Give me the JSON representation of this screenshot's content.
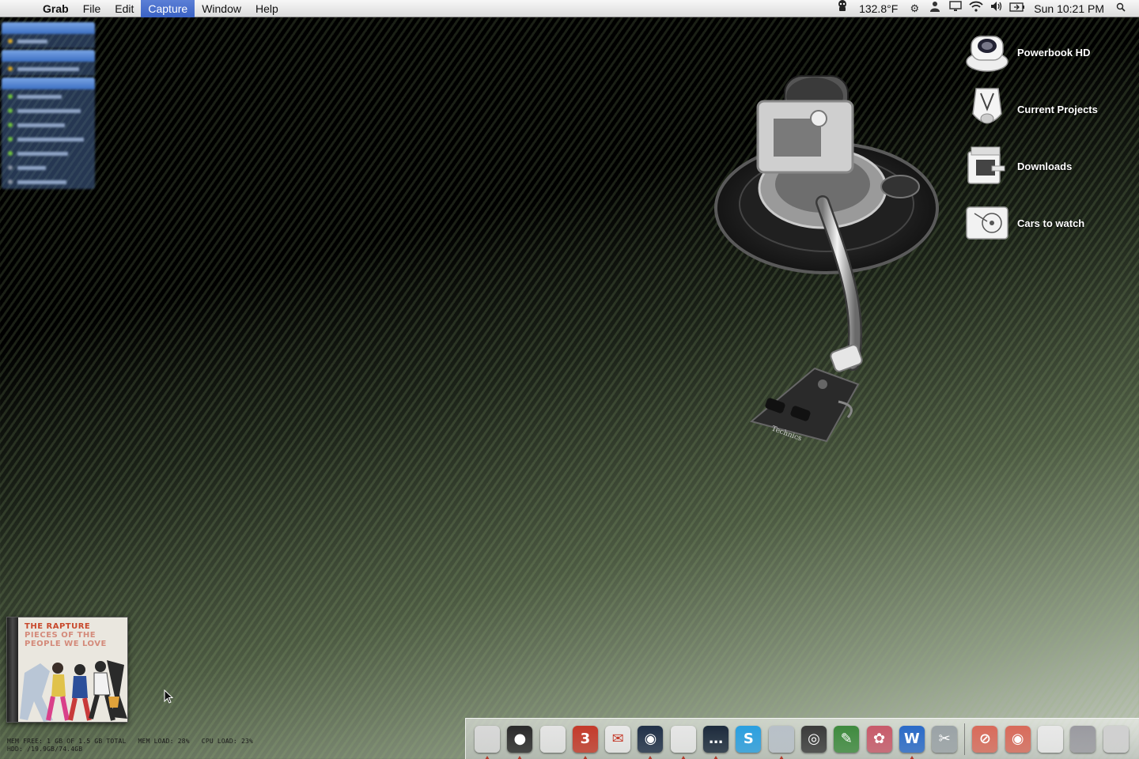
{
  "menubar": {
    "app_name": "Grab",
    "menus": [
      "File",
      "Edit",
      "Capture",
      "Window",
      "Help"
    ],
    "active_menu": "Capture",
    "temperature": "132.8°F",
    "clock": "Sun 10:21 PM",
    "status_icons": [
      "apple-icon",
      "temp-sensor-icon",
      "gear-icon",
      "user-icon",
      "display-icon",
      "wifi-icon",
      "volume-icon",
      "battery-icon",
      "spotlight-icon"
    ]
  },
  "desktop_icons": [
    {
      "label": "Powerbook HD",
      "icon": "hard-drive-icon"
    },
    {
      "label": "Current Projects",
      "icon": "projects-folder-icon"
    },
    {
      "label": "Downloads",
      "icon": "downloads-folder-icon"
    },
    {
      "label": "Cars to watch",
      "icon": "cars-folder-icon"
    }
  ],
  "album": {
    "band": "THE RAPTURE",
    "record": "PIECES OF THE PEOPLE WE LOVE"
  },
  "stats": {
    "line1": "MEM FREE: 1 GB OF 1.5 GB TOTAL   MEM LOAD: 28%   CPU LOAD: 23%",
    "line2": "HDD: /19.9GB/74.4GB"
  },
  "dock": {
    "apps": [
      {
        "name": "finder-icon",
        "glyph": "",
        "color": "#d8d8d8",
        "running": true
      },
      {
        "name": "dashboard-icon",
        "glyph": "●",
        "color": "#2a2a2a",
        "running": true
      },
      {
        "name": "text-edit-icon",
        "glyph": "",
        "color": "#e4e4e4",
        "running": false
      },
      {
        "name": "calendar-icon",
        "glyph": "3",
        "color": "#c43a2a",
        "running": true
      },
      {
        "name": "mail-icon",
        "glyph": "✉",
        "color": "#e8e8e8",
        "running": false
      },
      {
        "name": "itunes-icon",
        "glyph": "◉",
        "color": "#203048",
        "running": true
      },
      {
        "name": "preview-icon",
        "glyph": "",
        "color": "#e6e6e6",
        "running": true
      },
      {
        "name": "ichat-icon",
        "glyph": "…",
        "color": "#1c2a3c",
        "running": true
      },
      {
        "name": "skype-icon",
        "glyph": "S",
        "color": "#2a9fe0",
        "running": false
      },
      {
        "name": "acrobat-icon",
        "glyph": "",
        "color": "#b8c0c8",
        "running": true
      },
      {
        "name": "camera-icon",
        "glyph": "◎",
        "color": "#3a3a3a",
        "running": false
      },
      {
        "name": "feather-icon",
        "glyph": "✎",
        "color": "#3e8a3e",
        "running": false
      },
      {
        "name": "flower-icon",
        "glyph": "✿",
        "color": "#c85a6a",
        "running": false
      },
      {
        "name": "word-icon",
        "glyph": "W",
        "color": "#2a6ac8",
        "running": true
      },
      {
        "name": "utility-icon",
        "glyph": "✂",
        "color": "#9aa2a6",
        "running": false
      }
    ],
    "docs": [
      {
        "name": "no-entry-folder-icon",
        "glyph": "⊘",
        "color": "#d86a5a"
      },
      {
        "name": "disc-folder-icon",
        "glyph": "◉",
        "color": "#d86a5a"
      },
      {
        "name": "document-stack-icon",
        "glyph": "",
        "color": "#e8e8e8"
      },
      {
        "name": "stand-icon",
        "glyph": "",
        "color": "#9a9aa0"
      },
      {
        "name": "trash-icon",
        "glyph": "",
        "color": "#d0d0d0"
      }
    ]
  }
}
